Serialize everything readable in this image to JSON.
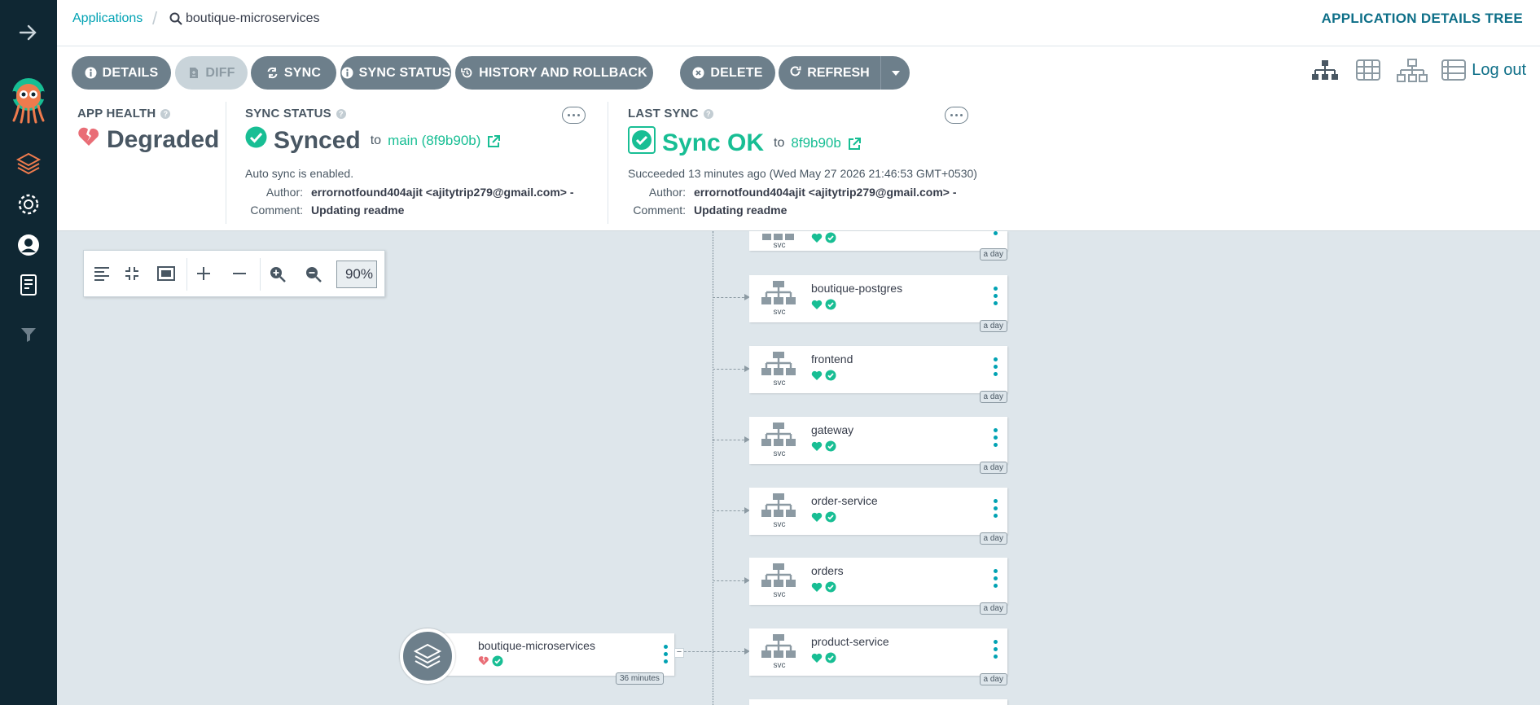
{
  "breadcrumb": {
    "applications": "Applications",
    "current": "boutique-microservices"
  },
  "page_title": "APPLICATION DETAILS TREE",
  "toolbar": {
    "details": "DETAILS",
    "diff": "DIFF",
    "sync": "SYNC",
    "sync_status": "SYNC STATUS",
    "history": "HISTORY AND ROLLBACK",
    "delete": "DELETE",
    "refresh": "REFRESH",
    "logout": "Log out"
  },
  "app_health": {
    "label": "APP HEALTH",
    "value": "Degraded"
  },
  "sync_status": {
    "label": "SYNC STATUS",
    "value": "Synced",
    "to": "to",
    "revision": "main (8f9b90b)",
    "auto_sync": "Auto sync is enabled.",
    "author_label": "Author:",
    "author": "errornotfound404ajit <ajitytrip279@gmail.com> -",
    "comment_label": "Comment:",
    "comment": "Updating readme"
  },
  "last_sync": {
    "label": "LAST SYNC",
    "value": "Sync OK",
    "to": "to",
    "revision": "8f9b90b",
    "succeeded": "Succeeded 13 minutes ago (Wed May 27 2026 21:46:53 GMT+0530)",
    "author_label": "Author:",
    "author": "errornotfound404ajit <ajitytrip279@gmail.com> -",
    "comment_label": "Comment:",
    "comment": "Updating readme"
  },
  "zoom": {
    "value": "90%"
  },
  "app_node": {
    "name": "boutique-microservices",
    "age": "36 minutes"
  },
  "resources": [
    {
      "name": "",
      "kind": "svc",
      "age": "a day"
    },
    {
      "name": "boutique-postgres",
      "kind": "svc",
      "age": "a day"
    },
    {
      "name": "frontend",
      "kind": "svc",
      "age": "a day"
    },
    {
      "name": "gateway",
      "kind": "svc",
      "age": "a day"
    },
    {
      "name": "order-service",
      "kind": "svc",
      "age": "a day"
    },
    {
      "name": "orders",
      "kind": "svc",
      "age": "a day"
    },
    {
      "name": "product-service",
      "kind": "svc",
      "age": "a day"
    }
  ],
  "colors": {
    "sidebar": "#0f2733",
    "accent": "#00a2b3",
    "healthy": "#18be94",
    "degraded": "#e96d76",
    "button": "#6d7f8b"
  }
}
